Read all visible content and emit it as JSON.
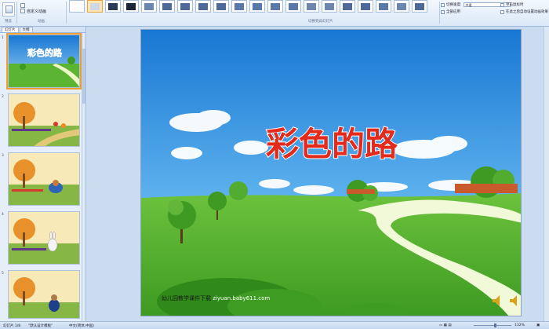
{
  "ribbon": {
    "preview_group_label": "预览",
    "custom_animation_label": "自定义动画",
    "animation_group_label": "动画",
    "transition_group_label": "切换到此幻灯片",
    "transition_speed_label": "切换速度:",
    "transition_speed_value": "中速",
    "apply_all_label": "全部应用",
    "on_click_label": "单击鼠标时",
    "auto_after_label": "在此之后自动设置动画效果",
    "transition_effects": [
      "none",
      "fade",
      "dark",
      "dark2",
      "dissolve",
      "push-down",
      "push-left",
      "push-right",
      "push-up",
      "wipe-up",
      "wipe-down",
      "wipe-left",
      "wipe-right",
      "split-h",
      "split-v",
      "box-in",
      "box-out",
      "corner",
      "strips",
      "zoom"
    ]
  },
  "panel": {
    "tabs": [
      "幻灯片",
      "大纲"
    ],
    "slides": [
      {
        "number": "1",
        "kind": "title"
      },
      {
        "number": "2",
        "kind": "autumn-road"
      },
      {
        "number": "3",
        "kind": "autumn-hedgehog"
      },
      {
        "number": "4",
        "kind": "autumn-rabbit"
      },
      {
        "number": "5",
        "kind": "autumn-bear"
      }
    ]
  },
  "slide": {
    "title": "彩色的路",
    "footer": "幼儿园教学课件下载 ",
    "footer_url": "ziyuan.baby611.com",
    "colors": {
      "sky_top": "#1877d3",
      "sky_bottom": "#a9dcf8",
      "grass": "#5bb533",
      "title_fill": "#e22a1d",
      "title_outline": "#ffffff"
    }
  },
  "status": {
    "slide_info": "幻灯片 1/8",
    "theme": "\"默认设计模板\"",
    "language": "中文(简体,中国)",
    "zoom": "132%"
  }
}
